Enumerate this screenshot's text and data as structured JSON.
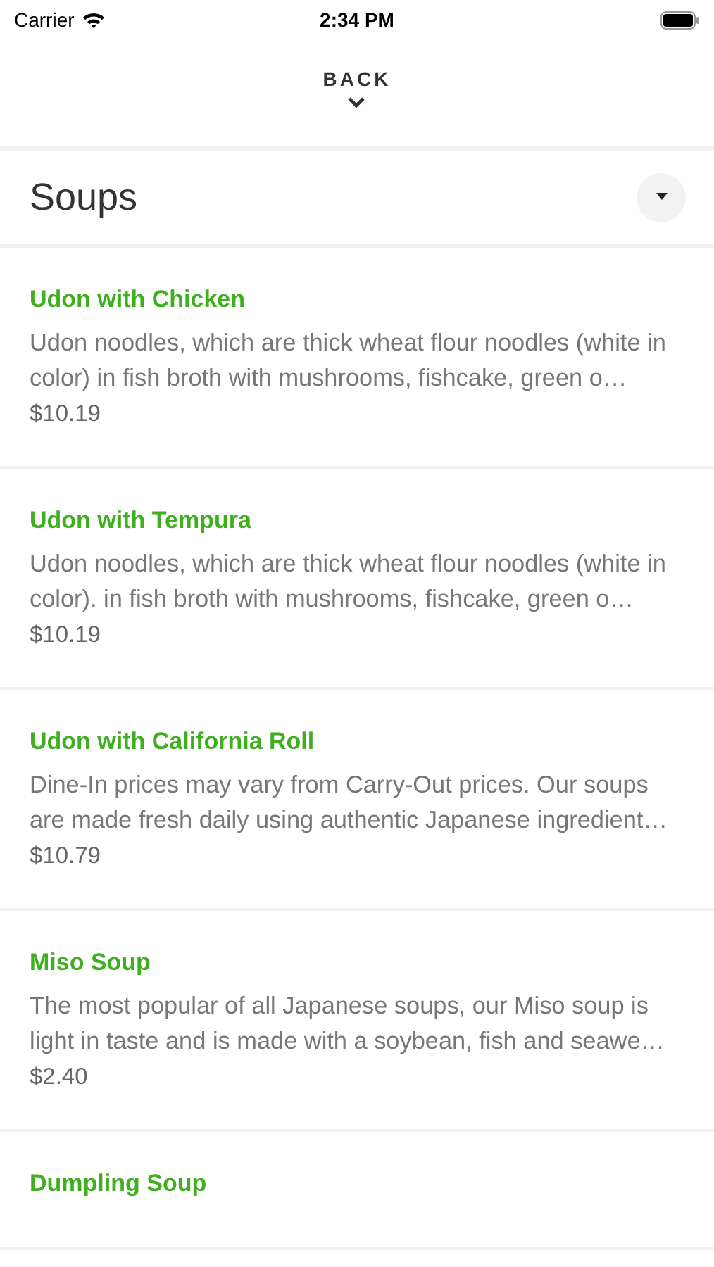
{
  "status_bar": {
    "carrier": "Carrier",
    "time": "2:34 PM"
  },
  "nav": {
    "back_label": "BACK"
  },
  "section": {
    "title": "Soups",
    "expanded": true
  },
  "items": [
    {
      "name": "Udon with Chicken",
      "description": "Udon noodles, which are thick wheat flour noodles (white in color) in fish broth with mushrooms, fishcake, green o…",
      "price": "$10.19"
    },
    {
      "name": "Udon with Tempura",
      "description": "Udon noodles, which are thick wheat flour noodles (white in color). in fish broth with mushrooms, fishcake, green o…",
      "price": "$10.19"
    },
    {
      "name": "Udon with California Roll",
      "description": "Dine-In prices may vary from Carry-Out prices. Our soups are made fresh daily using authentic Japanese ingredient…",
      "price": "$10.79"
    },
    {
      "name": "Miso Soup",
      "description": "The most popular of all Japanese soups, our Miso soup is light in taste and is made with a soybean, fish and seawe…",
      "price": "$2.40"
    },
    {
      "name": "Dumpling Soup"
    }
  ]
}
